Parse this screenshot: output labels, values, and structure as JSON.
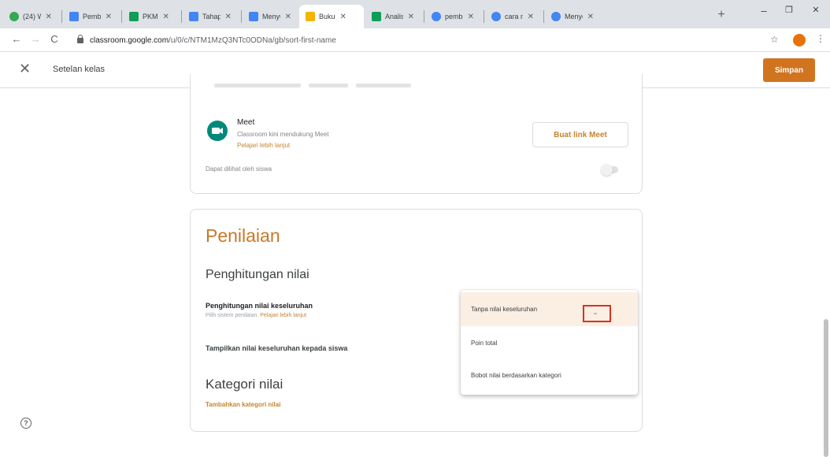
{
  "browser": {
    "tabs": [
      {
        "label": "(24) W",
        "color": "#34a853",
        "active": false
      },
      {
        "label": "Pemb",
        "color": "#4285f4",
        "active": false
      },
      {
        "label": "PKM",
        "color": "#0f9d58",
        "active": false
      },
      {
        "label": "Tahap",
        "color": "#4285f4",
        "active": false
      },
      {
        "label": "Menyu",
        "color": "#4285f4",
        "active": false
      },
      {
        "label": "Buku",
        "color": "#f4b400",
        "active": true
      },
      {
        "label": "Analis",
        "color": "#0f9d58",
        "active": false
      },
      {
        "label": "pembe",
        "color": "#4285f4",
        "active": false
      },
      {
        "label": "cara m",
        "color": "#4285f4",
        "active": false
      },
      {
        "label": "Menye",
        "color": "#4285f4",
        "active": false
      }
    ],
    "new_tab": "+",
    "window_controls": {
      "minimize": "–",
      "maximize": "❐",
      "close": "✕"
    },
    "back": "←",
    "forward": "→",
    "reload": "C",
    "url_host": "classroom.google.com",
    "url_path": "/u/0/c/NTM1MzQ3NTc0ODNa/gb/sort-first-name",
    "star": "☆",
    "menu": "⋮"
  },
  "header": {
    "close_icon": "✕",
    "title": "Setelan kelas",
    "save_label": "Simpan"
  },
  "meet": {
    "title": "Meet",
    "description": "Classroom kini mendukung Meet",
    "learn_more": "Pelajari lebih lanjut",
    "button_label": "Buat link Meet",
    "visible_label": "Dapat dilihat oleh siswa"
  },
  "grading": {
    "title": "Penilaian",
    "calc_heading": "Penghitungan nilai",
    "overall_label": "Penghitungan nilai keseluruhan",
    "overall_sub": "Pilih sistem penilaian.",
    "overall_sub_link": "Pelajari lebih lanjut",
    "show_label": "Tampilkan nilai keseluruhan kepada siswa",
    "category_heading": "Kategori nilai",
    "add_category": "Tambahkan kategori nilai"
  },
  "dropdown": {
    "options": [
      {
        "label": "Tanpa nilai keseluruhan",
        "selected": true
      },
      {
        "label": "Poin total",
        "selected": false
      },
      {
        "label": "Bobot nilai berdasarkan kategori",
        "selected": false
      }
    ]
  },
  "help_icon": "?",
  "colors": {
    "accent": "#d1741f",
    "heading_orange": "#c97828",
    "selected_bg": "#fbeee2",
    "highlight_red": "#d93025"
  }
}
